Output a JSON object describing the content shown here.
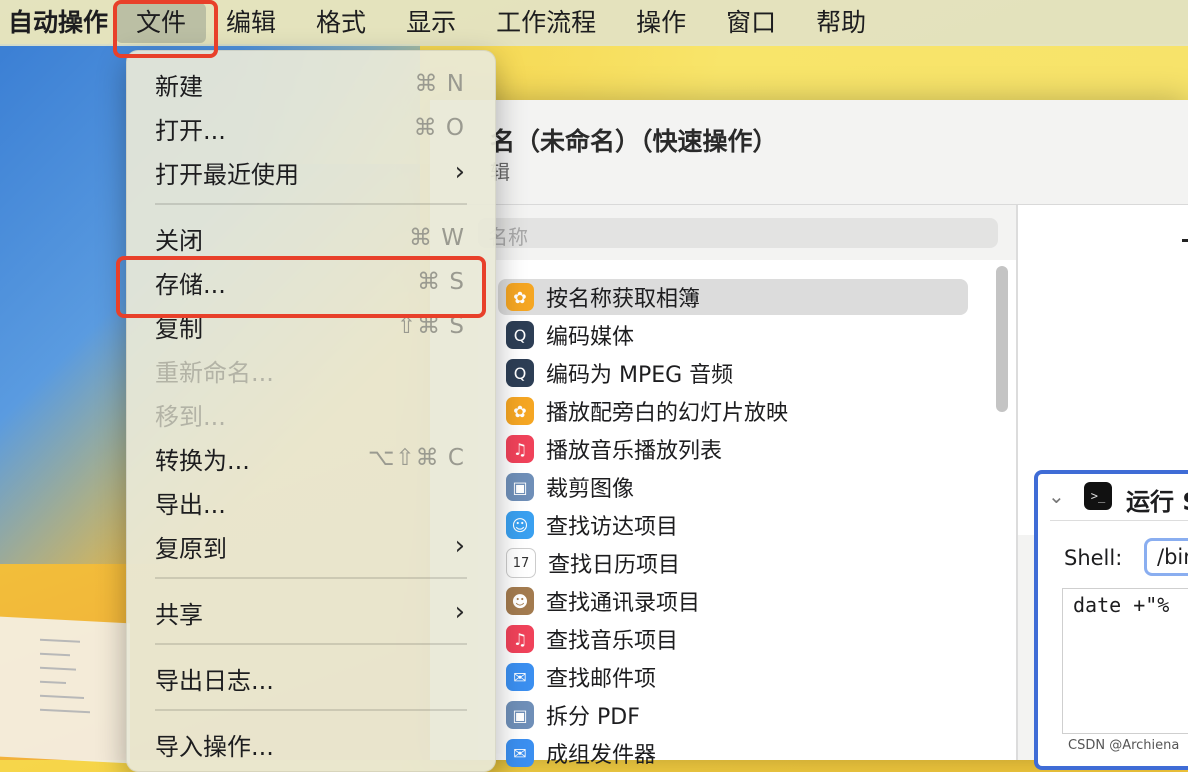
{
  "menubar": {
    "app_name": "自动操作",
    "items": [
      "文件",
      "编辑",
      "格式",
      "显示",
      "工作流程",
      "操作",
      "窗口",
      "帮助"
    ]
  },
  "file_menu": {
    "new": {
      "label": "新建",
      "shortcut": "⌘ N"
    },
    "open": {
      "label": "打开...",
      "shortcut": "⌘ O"
    },
    "open_recent": {
      "label": "打开最近使用",
      "arrow": "›"
    },
    "close": {
      "label": "关闭",
      "shortcut": "⌘ W"
    },
    "save": {
      "label": "存储...",
      "shortcut": "⌘ S"
    },
    "duplicate": {
      "label": "复制",
      "shortcut": "⇧⌘ S"
    },
    "rename": {
      "label": "重新命名..."
    },
    "move_to": {
      "label": "移到..."
    },
    "convert_to": {
      "label": "转换为...",
      "shortcut": "⌥⇧⌘ C"
    },
    "export": {
      "label": "导出..."
    },
    "revert_to": {
      "label": "复原到",
      "arrow": "›"
    },
    "share": {
      "label": "共享",
      "arrow": "›"
    },
    "export_log": {
      "label": "导出日志..."
    },
    "import_actions": {
      "label": "导入操作..."
    }
  },
  "window": {
    "title": "名（未命名）（快速操作）",
    "subtitle": "辑",
    "search_placeholder": "名称"
  },
  "actions_list": [
    {
      "label": "按名称获取相簿",
      "icon": "photos-icon",
      "color": "#f5a623",
      "glyph": "✿"
    },
    {
      "label": "编码媒体",
      "icon": "quicktime-icon",
      "color": "#2d3e55",
      "glyph": "Q"
    },
    {
      "label": "编码为 MPEG 音频",
      "icon": "quicktime-icon",
      "color": "#2d3e55",
      "glyph": "Q"
    },
    {
      "label": "播放配旁白的幻灯片放映",
      "icon": "photos-icon",
      "color": "#f5a623",
      "glyph": "✿"
    },
    {
      "label": "播放音乐播放列表",
      "icon": "music-icon",
      "color": "#f0425a",
      "glyph": "♫"
    },
    {
      "label": "裁剪图像",
      "icon": "preview-icon",
      "color": "#6f8fb8",
      "glyph": "▣"
    },
    {
      "label": "查找访达项目",
      "icon": "finder-icon",
      "color": "#3aa0f0",
      "glyph": "☺"
    },
    {
      "label": "查找日历项目",
      "icon": "calendar-icon",
      "color": "#ffffff",
      "glyph": "17"
    },
    {
      "label": "查找通讯录项目",
      "icon": "contacts-icon",
      "color": "#a37b4f",
      "glyph": "☻"
    },
    {
      "label": "查找音乐项目",
      "icon": "music-icon",
      "color": "#f0425a",
      "glyph": "♫"
    },
    {
      "label": "查找邮件项",
      "icon": "mail-icon",
      "color": "#3b8ff0",
      "glyph": "✉"
    },
    {
      "label": "拆分 PDF",
      "icon": "preview-icon",
      "color": "#6f8fb8",
      "glyph": "▣"
    },
    {
      "label": "成组发件器",
      "icon": "mail-icon",
      "color": "#3b8ff0",
      "glyph": "✉"
    }
  ],
  "action_card": {
    "title": "运行 S",
    "shell_label": "Shell:",
    "shell_value": "/bin",
    "code": "date +\"%"
  },
  "watermark": "CSDN @Archiena",
  "colors": {
    "highlight": "#e8402a",
    "selection_border": "#3f6cd6"
  }
}
